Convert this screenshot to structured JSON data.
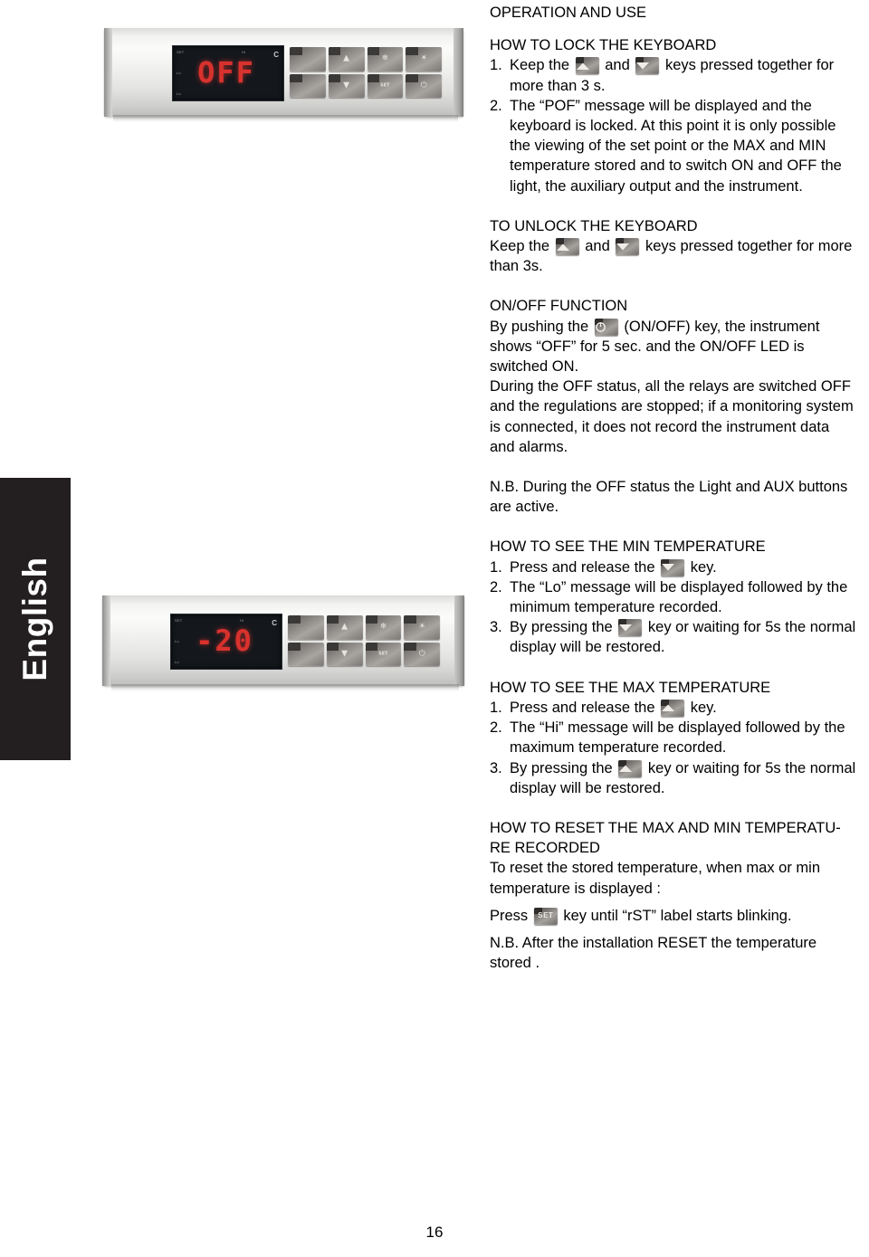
{
  "language_tab": {
    "label": "English"
  },
  "page": {
    "number": "16"
  },
  "panels": [
    {
      "name": "control-panel-off",
      "display_value": "OFF",
      "unit": "C",
      "micro_labels": [
        "SET",
        "Hi",
        "Lo",
        "Lo"
      ],
      "keys": [
        {
          "name": "key-blank-top",
          "glyph": ""
        },
        {
          "name": "key-up",
          "glyph": "▲"
        },
        {
          "name": "key-defrost",
          "glyph": "❄"
        },
        {
          "name": "key-light",
          "glyph": "☀"
        },
        {
          "name": "key-blank-bottom",
          "glyph": ""
        },
        {
          "name": "key-down",
          "glyph": "▼"
        },
        {
          "name": "key-set",
          "glyph": "SET"
        },
        {
          "name": "key-onoff",
          "glyph": "⏻"
        }
      ]
    },
    {
      "name": "control-panel-minus20",
      "display_value": "-20",
      "unit": "C",
      "micro_labels": [
        "SET",
        "Hi",
        "Lo",
        "Lo"
      ],
      "keys": [
        {
          "name": "key-blank-top",
          "glyph": ""
        },
        {
          "name": "key-up",
          "glyph": "▲"
        },
        {
          "name": "key-defrost",
          "glyph": "❄"
        },
        {
          "name": "key-light",
          "glyph": "☀"
        },
        {
          "name": "key-blank-bottom",
          "glyph": ""
        },
        {
          "name": "key-down",
          "glyph": "▼"
        },
        {
          "name": "key-set",
          "glyph": "SET"
        },
        {
          "name": "key-onoff",
          "glyph": "⏻"
        }
      ]
    }
  ],
  "content": {
    "section_title": "OPERATION AND USE",
    "lock_heading": "HOW TO LOCK THE KEYBOARD",
    "lock_step1_num": "1.",
    "lock_step1_a": "Keep the",
    "lock_step1_b": "and",
    "lock_step1_c": "keys pressed together for more than 3 s.",
    "lock_step2_num": "2.",
    "lock_step2": "The “POF” message will be displayed and the keyboard is locked. At this point it is only possible the viewing of the set point or the MAX and MIN temperature stored and to switch ON and OFF the light, the auxiliary output and the instrument.",
    "unlock_heading": "TO UNLOCK THE KEYBOARD",
    "unlock_a": "Keep the",
    "unlock_b": "and",
    "unlock_c": "keys pressed together for more than 3s.",
    "onoff_heading": "ON/OFF FUNCTION",
    "onoff_a": "By pushing the",
    "onoff_b": "(ON/OFF) key, the instrument shows “OFF” for 5 sec. and the ON/OFF LED is switched ON.",
    "onoff_para2": "During the OFF status, all the relays are switched OFF and the regulations are stopped; if a monitoring system is connected, it does not record the instrument data and alarms.",
    "onoff_nb": "N.B. During the OFF status the Light and AUX buttons are active.",
    "min_heading": "HOW TO SEE THE MIN TEMPERATURE",
    "min_step1_num": "1.",
    "min_step1_a": "Press and release the",
    "min_step1_b": "key.",
    "min_step2_num": "2.",
    "min_step2": "The “Lo” message will be displayed followed by the minimum temperature recorded.",
    "min_step3_num": "3.",
    "min_step3_a": "By pressing the",
    "min_step3_b": "key or waiting for 5s the normal display will be restored.",
    "max_heading": "HOW TO SEE THE MAX TEMPERATURE",
    "max_step1_num": "1.",
    "max_step1_a": "Press and release the",
    "max_step1_b": "key.",
    "max_step2_num": "2.",
    "max_step2": "The “Hi” message will be displayed followed by the maximum temperature recorded.",
    "max_step3_num": "3.",
    "max_step3_a": "By pressing the",
    "max_step3_b": "key or waiting for 5s the normal display will be restored.",
    "reset_heading": "HOW TO RESET THE MAX AND MIN TEMPERATU-RE RECORDED",
    "reset_para": "To reset the stored temperature, when max or min temperature is displayed :",
    "reset_press_a": "Press",
    "reset_press_b": "key until “rST” label starts blinking.",
    "reset_nb": "N.B. After the installation RESET the temperature stored ."
  },
  "icons": {
    "up_key": "up-arrow-key-icon",
    "down_key": "down-arrow-key-icon",
    "onoff_key": "power-key-icon",
    "set_key": "set-key-icon",
    "set_label": "SET"
  }
}
